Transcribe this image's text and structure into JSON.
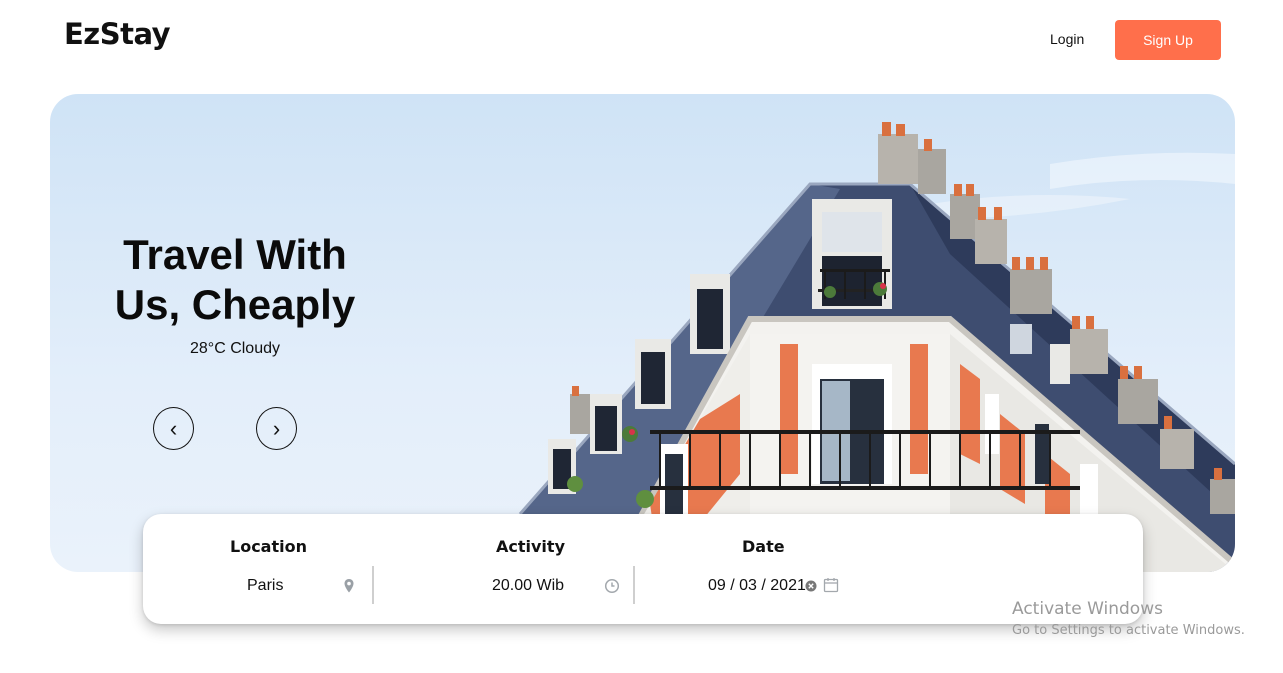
{
  "header": {
    "logo": "EzStay",
    "login_label": "Login",
    "signup_label": "Sign Up"
  },
  "hero": {
    "title": "Travel With Us, Cheaply",
    "weather": "28°C Cloudy",
    "prev_icon": "‹",
    "next_icon": "›"
  },
  "search": {
    "location": {
      "label": "Location",
      "value": "Paris",
      "icon": "map-pin-icon"
    },
    "activity": {
      "label": "Activity",
      "value": "20.00 Wib",
      "icon": "clock-icon"
    },
    "date": {
      "label": "Date",
      "value": "09 / 03 / 2021",
      "clear_icon": "clear-icon",
      "calendar_icon": "calendar-icon"
    }
  },
  "watermark": {
    "title": "Activate Windows",
    "subtitle": "Go to Settings to activate Windows."
  },
  "colors": {
    "accent": "#ff6f4b",
    "sky": "#d6e8f8",
    "roof": "#3b4a6b",
    "facade": "#f0f0ee",
    "brick": "#e8794f"
  }
}
